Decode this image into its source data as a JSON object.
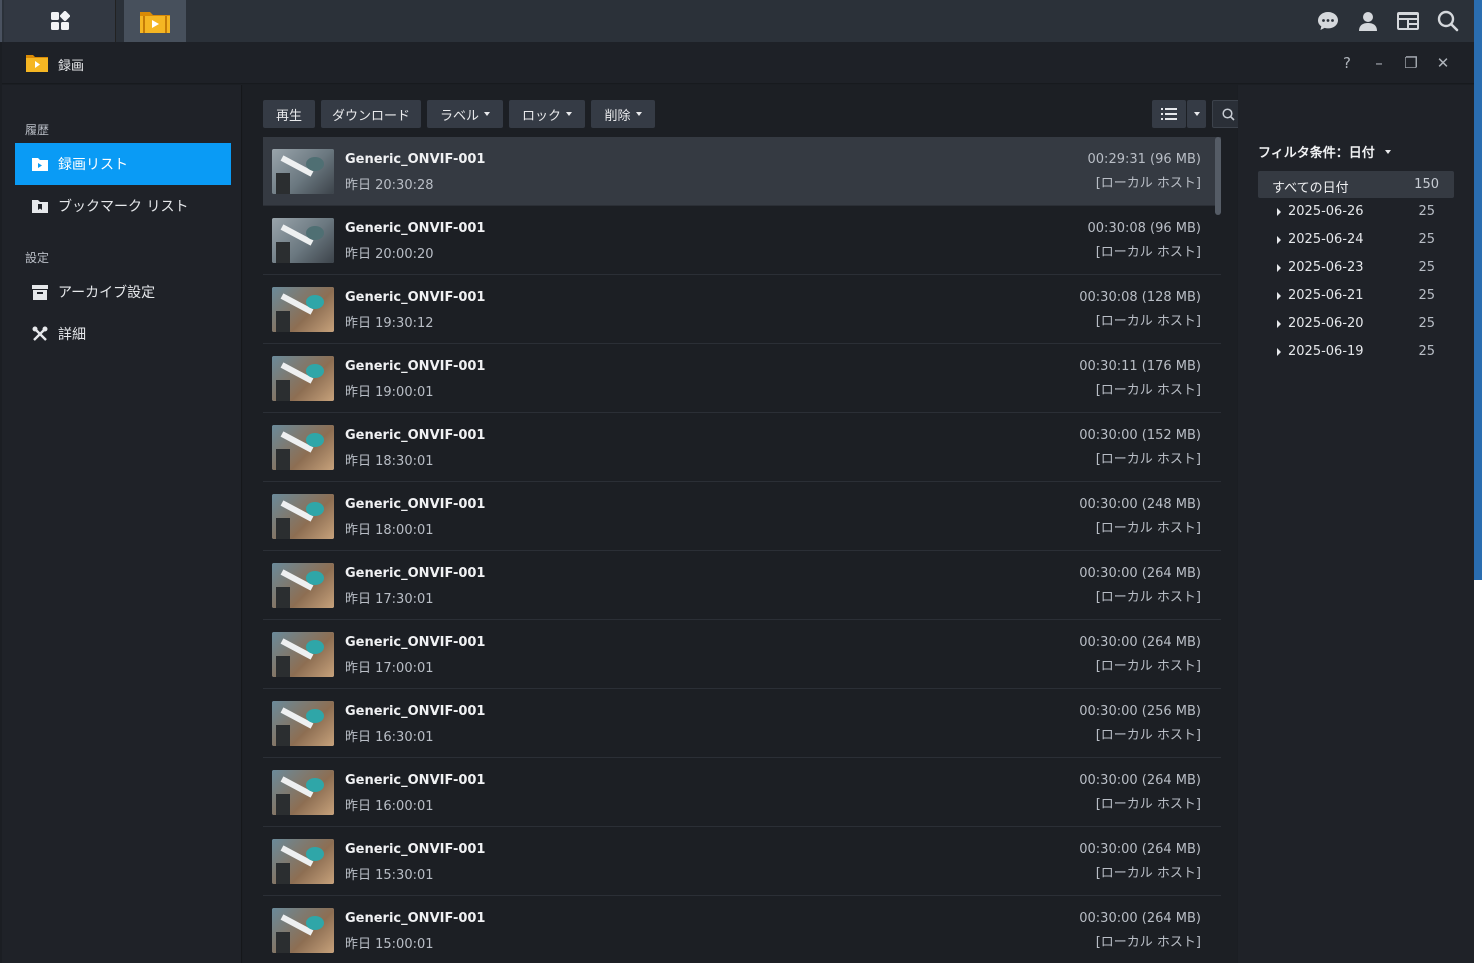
{
  "window": {
    "title": "録画"
  },
  "taskbar": {
    "main_menu": "main-menu",
    "app": "video-app",
    "right_icons": [
      "chat-icon",
      "user-icon",
      "widgets-icon",
      "search-icon"
    ]
  },
  "controls": {
    "help": "?",
    "minimize": "–",
    "maximize": "❐",
    "close": "✕"
  },
  "sidebar": {
    "section_history": "履歴",
    "recording_list": "録画リスト",
    "bookmark_list": "ブックマーク リスト",
    "section_settings": "設定",
    "archive_settings": "アーカイブ設定",
    "details": "詳細"
  },
  "toolbar": {
    "play": "再生",
    "download": "ダウンロード",
    "label": "ラベル",
    "lock": "ロック",
    "delete": "削除",
    "search_placeholder": "検索"
  },
  "recordings": [
    {
      "name": "Generic_ONVIF-001",
      "time": "昨日 20:30:28",
      "duration": "00:29:31 (96 MB)",
      "host": "[ローカル ホスト]"
    },
    {
      "name": "Generic_ONVIF-001",
      "time": "昨日 20:00:20",
      "duration": "00:30:08 (96 MB)",
      "host": "[ローカル ホスト]"
    },
    {
      "name": "Generic_ONVIF-001",
      "time": "昨日 19:30:12",
      "duration": "00:30:08 (128 MB)",
      "host": "[ローカル ホスト]"
    },
    {
      "name": "Generic_ONVIF-001",
      "time": "昨日 19:00:01",
      "duration": "00:30:11 (176 MB)",
      "host": "[ローカル ホスト]"
    },
    {
      "name": "Generic_ONVIF-001",
      "time": "昨日 18:30:01",
      "duration": "00:30:00 (152 MB)",
      "host": "[ローカル ホスト]"
    },
    {
      "name": "Generic_ONVIF-001",
      "time": "昨日 18:00:01",
      "duration": "00:30:00 (248 MB)",
      "host": "[ローカル ホスト]"
    },
    {
      "name": "Generic_ONVIF-001",
      "time": "昨日 17:30:01",
      "duration": "00:30:00 (264 MB)",
      "host": "[ローカル ホスト]"
    },
    {
      "name": "Generic_ONVIF-001",
      "time": "昨日 17:00:01",
      "duration": "00:30:00 (264 MB)",
      "host": "[ローカル ホスト]"
    },
    {
      "name": "Generic_ONVIF-001",
      "time": "昨日 16:30:01",
      "duration": "00:30:00 (256 MB)",
      "host": "[ローカル ホスト]"
    },
    {
      "name": "Generic_ONVIF-001",
      "time": "昨日 16:00:01",
      "duration": "00:30:00 (264 MB)",
      "host": "[ローカル ホスト]"
    },
    {
      "name": "Generic_ONVIF-001",
      "time": "昨日 15:30:01",
      "duration": "00:30:00 (264 MB)",
      "host": "[ローカル ホスト]"
    },
    {
      "name": "Generic_ONVIF-001",
      "time": "昨日 15:00:01",
      "duration": "00:30:00 (264 MB)",
      "host": "[ローカル ホスト]"
    }
  ],
  "filter": {
    "title": "フィルタ条件：日付",
    "all_label": "すべての日付",
    "all_count": "150",
    "dates": [
      {
        "date": "2025-06-26",
        "count": "25"
      },
      {
        "date": "2025-06-24",
        "count": "25"
      },
      {
        "date": "2025-06-23",
        "count": "25"
      },
      {
        "date": "2025-06-21",
        "count": "25"
      },
      {
        "date": "2025-06-20",
        "count": "25"
      },
      {
        "date": "2025-06-19",
        "count": "25"
      }
    ]
  },
  "colors": {
    "accent": "#0a9bf5",
    "app_icon": "#f5a623"
  }
}
